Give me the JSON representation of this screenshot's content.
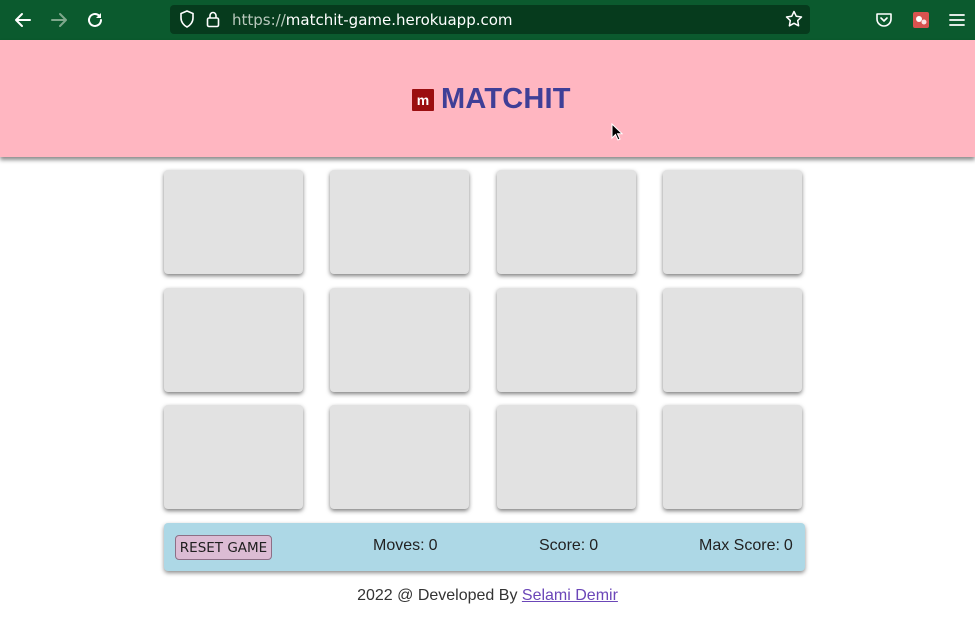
{
  "browser": {
    "url_scheme": "https://",
    "url_host": "matchit-game.herokuapp.com",
    "icons": [
      "back-icon",
      "forward-icon",
      "reload-icon",
      "shield-icon",
      "lock-icon",
      "star-icon",
      "pocket-icon",
      "extension-icon",
      "menu-icon"
    ]
  },
  "header": {
    "logo_letter": "m",
    "title": "MATCHIT",
    "background": "#ffb6c1",
    "title_color": "#3f3f97"
  },
  "cards": [
    {
      "state": "face-down"
    },
    {
      "state": "face-down"
    },
    {
      "state": "face-down"
    },
    {
      "state": "face-down"
    },
    {
      "state": "face-down"
    },
    {
      "state": "face-down"
    },
    {
      "state": "face-down"
    },
    {
      "state": "face-down"
    },
    {
      "state": "face-down"
    },
    {
      "state": "face-down"
    },
    {
      "state": "face-down"
    },
    {
      "state": "face-down"
    }
  ],
  "score_bar": {
    "reset_label": "RESET GAME",
    "moves_label": "Moves:",
    "moves_value": "0",
    "score_label": "Score:",
    "score_value": "0",
    "max_score_label": "Max Score:",
    "max_score_value": "0"
  },
  "footer": {
    "prefix": "2022 @ Developed By",
    "author": "Selami Demir"
  }
}
